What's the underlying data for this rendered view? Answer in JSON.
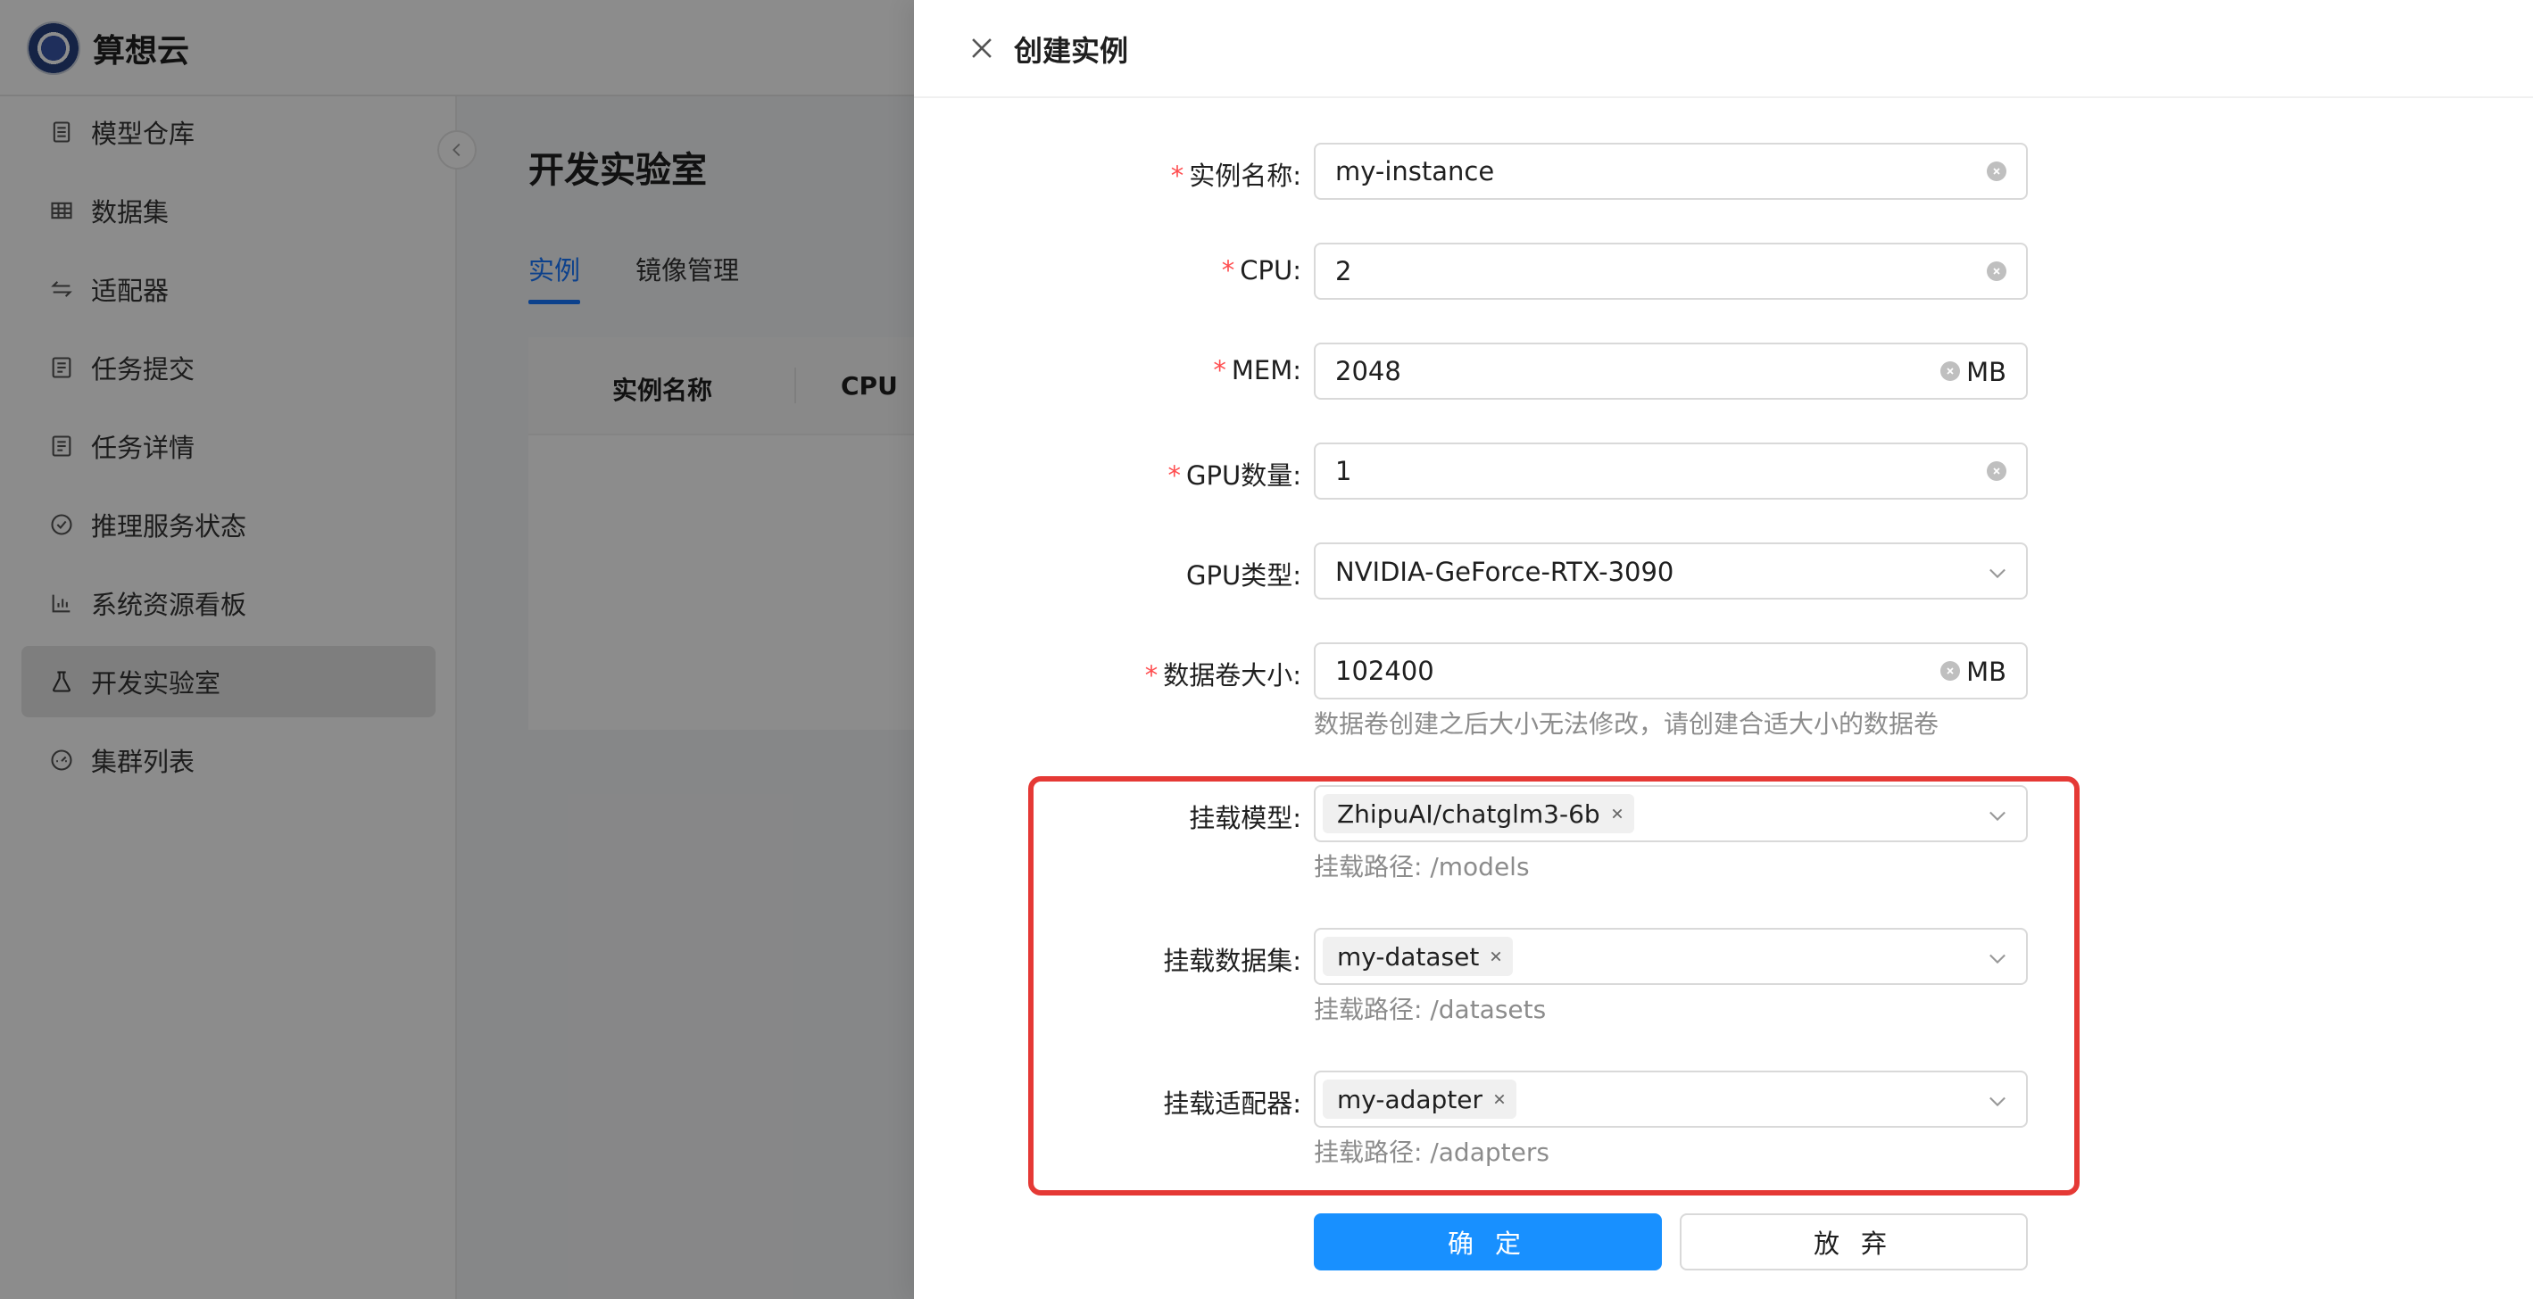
{
  "brand": {
    "name": "算想云"
  },
  "sidebar": {
    "items": [
      {
        "label": "模型仓库",
        "icon": "book-icon"
      },
      {
        "label": "数据集",
        "icon": "table-icon"
      },
      {
        "label": "适配器",
        "icon": "swap-icon"
      },
      {
        "label": "任务提交",
        "icon": "list-icon"
      },
      {
        "label": "任务详情",
        "icon": "list-icon"
      },
      {
        "label": "推理服务状态",
        "icon": "check-circle-icon"
      },
      {
        "label": "系统资源看板",
        "icon": "bar-chart-icon"
      },
      {
        "label": "开发实验室",
        "icon": "flask-icon",
        "active": true
      },
      {
        "label": "集群列表",
        "icon": "dashboard-icon"
      }
    ]
  },
  "main": {
    "title": "开发实验室",
    "tabs": [
      {
        "label": "实例",
        "active": true
      },
      {
        "label": "镜像管理",
        "active": false
      }
    ],
    "table": {
      "columns": [
        "实例名称",
        "CPU"
      ]
    }
  },
  "drawer": {
    "title": "创建实例",
    "fields": {
      "name": {
        "label": "实例名称",
        "value": "my-instance",
        "required": true
      },
      "cpu": {
        "label": "CPU",
        "value": "2",
        "required": true
      },
      "mem": {
        "label": "MEM",
        "value": "2048",
        "suffix": "MB",
        "required": true
      },
      "gpu_count": {
        "label": "GPU数量",
        "value": "1",
        "required": true
      },
      "gpu_type": {
        "label": "GPU类型",
        "value": "NVIDIA-GeForce-RTX-3090",
        "required": false
      },
      "volume": {
        "label": "数据卷大小",
        "value": "102400",
        "suffix": "MB",
        "required": true,
        "hint": "数据卷创建之后大小无法修改，请创建合适大小的数据卷"
      },
      "mount_model": {
        "label": "挂载模型",
        "tag": "ZhipuAI/chatglm3-6b",
        "hint": "挂载路径: /models"
      },
      "mount_dataset": {
        "label": "挂载数据集",
        "tag": "my-dataset",
        "hint": "挂载路径: /datasets"
      },
      "mount_adapter": {
        "label": "挂载适配器",
        "tag": "my-adapter",
        "hint": "挂载路径: /adapters"
      }
    },
    "required_mark": "*",
    "label_colon": ":",
    "buttons": {
      "confirm": "确 定",
      "cancel": "放 弃"
    }
  },
  "colors": {
    "primary": "#1890ff",
    "tab_active": "#1677ff",
    "required": "#ff4d4f",
    "highlight_border": "#e53935",
    "hint": "#8c8c8c"
  }
}
